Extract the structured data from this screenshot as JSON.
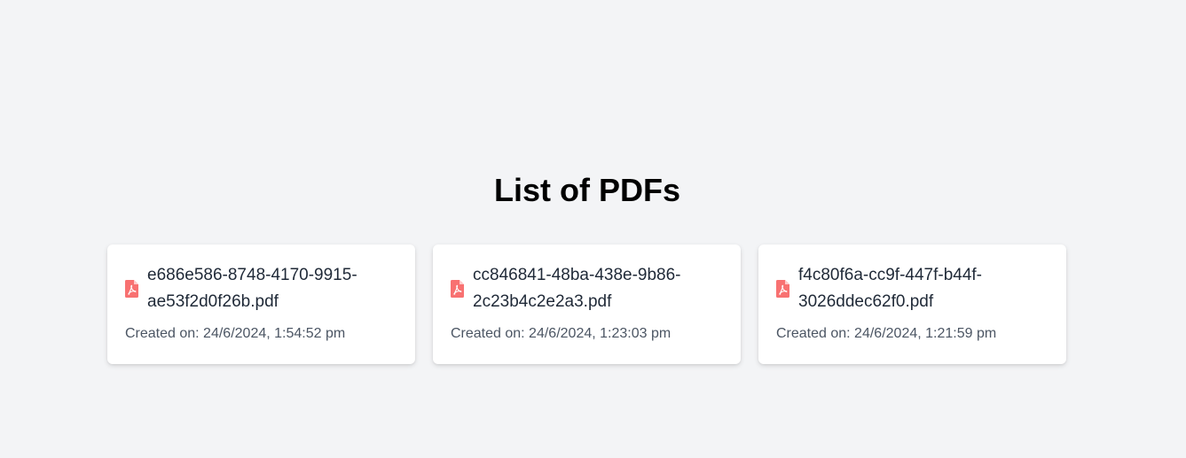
{
  "page": {
    "title": "List of PDFs"
  },
  "pdfs": [
    {
      "name": "e686e586-8748-4170-9915-ae53f2d0f26b.pdf",
      "created": "Created on: 24/6/2024, 1:54:52 pm"
    },
    {
      "name": "cc846841-48ba-438e-9b86-2c23b4c2e2a3.pdf",
      "created": "Created on: 24/6/2024, 1:23:03 pm"
    },
    {
      "name": "f4c80f6a-cc9f-447f-b44f-3026ddec62f0.pdf",
      "created": "Created on: 24/6/2024, 1:21:59 pm"
    }
  ],
  "icons": {
    "file": "file-pdf-icon"
  },
  "colors": {
    "background": "#f3f4f6",
    "card": "#ffffff",
    "pdf_icon": "#f87171",
    "text": "#1f2937",
    "muted": "#4b5563"
  }
}
